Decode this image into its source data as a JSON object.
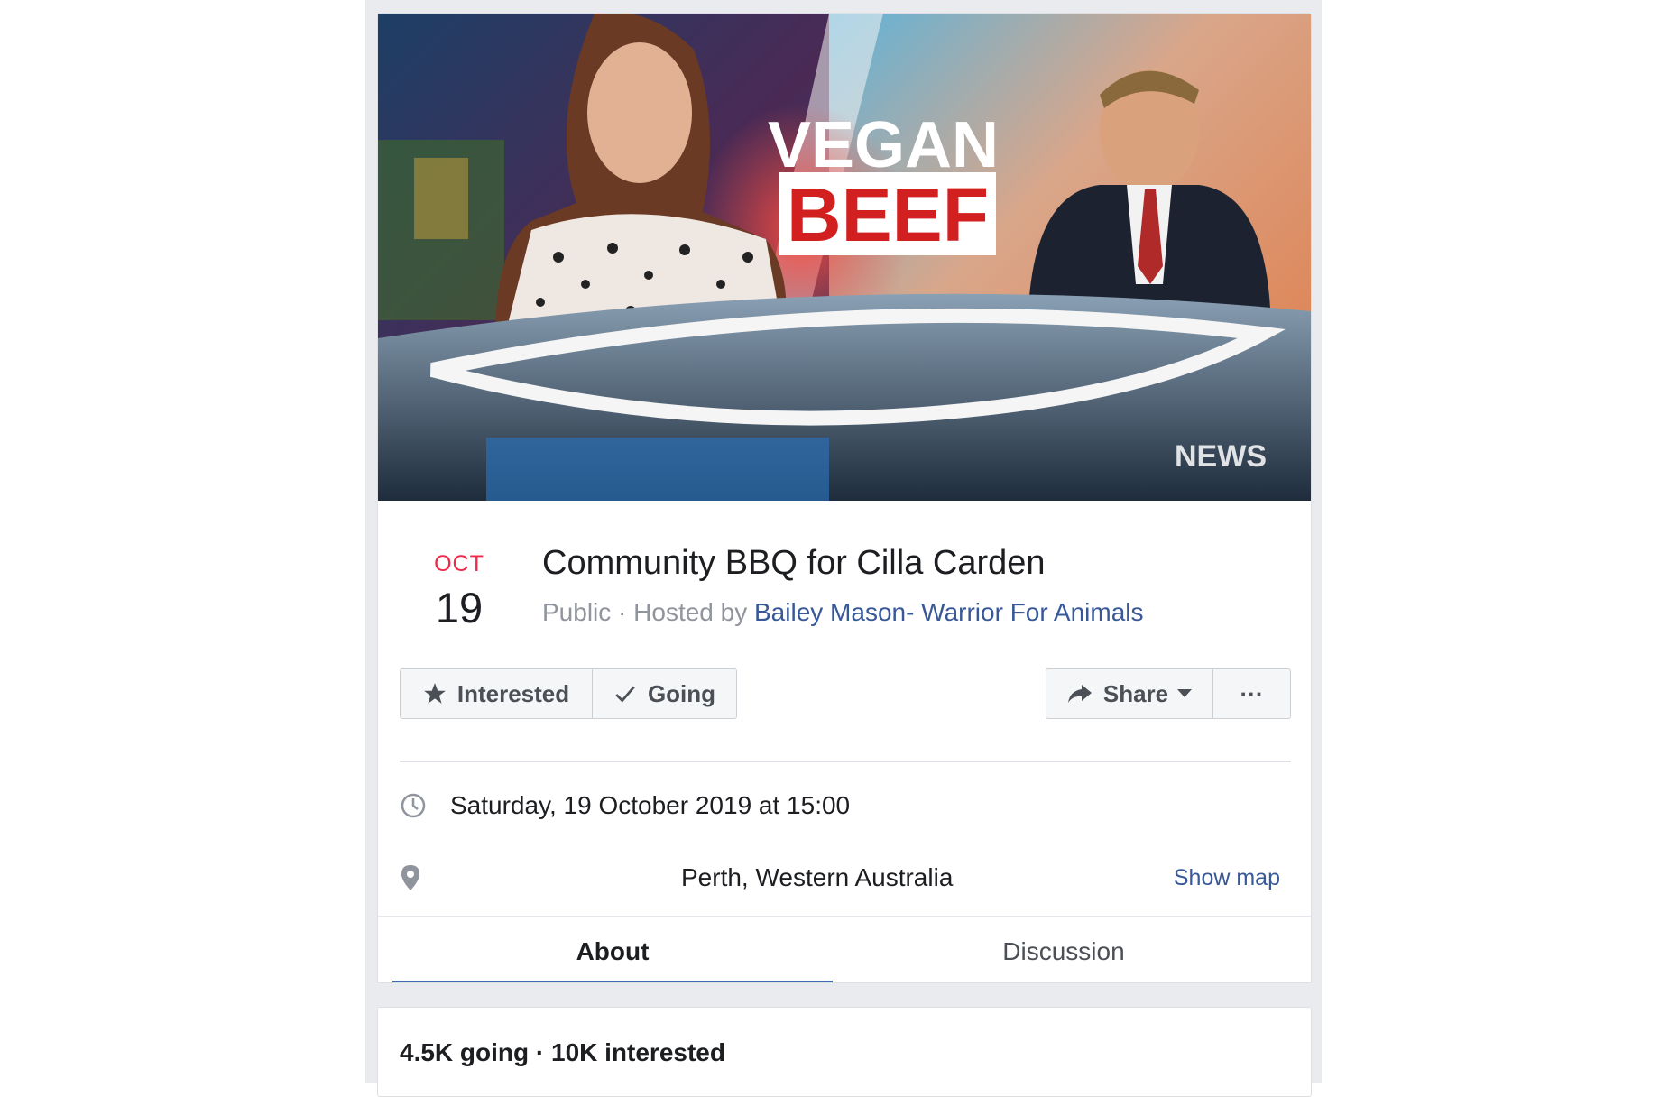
{
  "cover": {
    "headline_top": "VEGAN",
    "headline_bottom": "BEEF",
    "watermark": "NEWS"
  },
  "event": {
    "month": "OCT",
    "day": "19",
    "title": "Community BBQ for Cilla Carden",
    "privacy": "Public",
    "hosted_prefix": " · Hosted by ",
    "host_name": "Bailey Mason- Warrior For Animals"
  },
  "actions": {
    "interested_label": "Interested",
    "going_label": "Going",
    "share_label": "Share",
    "more_label": "···"
  },
  "details": {
    "datetime": "Saturday, 19 October 2019 at 15:00",
    "location": "Perth, Western Australia",
    "show_map_label": "Show map"
  },
  "tabs": [
    {
      "label": "About",
      "active": true
    },
    {
      "label": "Discussion",
      "active": false
    }
  ],
  "stats": {
    "summary": "4.5K going · 10K interested"
  },
  "colors": {
    "date_month": "#f02849",
    "link": "#385898",
    "tab_indicator": "#4267b2"
  }
}
